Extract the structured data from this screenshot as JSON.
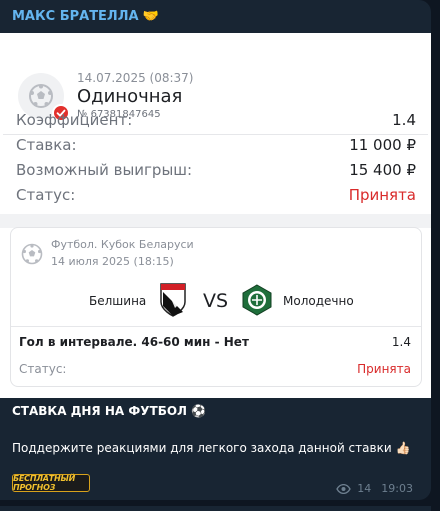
{
  "message": {
    "sender": "МАКС БРАТЕЛЛА",
    "sender_emoji": "🤝",
    "caption": "СТАВКА ДНЯ НА ФУТБОЛ",
    "caption_emoji": "⚽",
    "text": "Поддержите реакциями для легкого захода данной ставки",
    "text_emoji": "👍🏻",
    "badge": "БЕСПЛАТНЫЙ ПРОГНОЗ",
    "views": "14",
    "time": "19:03"
  },
  "coupon": {
    "date": "14.07.2025 (08:37)",
    "type": "Одиночная",
    "id": "№ 67381847645",
    "rows": [
      {
        "label": "Коэффициент:",
        "value": "1.4"
      },
      {
        "label": "Ставка:",
        "value": "11 000 ₽"
      },
      {
        "label": "Возможный выигрыш:",
        "value": "15 400 ₽"
      },
      {
        "label": "Статус:",
        "value": "Принята"
      }
    ],
    "event": {
      "league": "Футбол. Кубок Беларуси",
      "date": "14 июля 2025 (18:15)",
      "team1": "Белшина",
      "vs": "VS",
      "team2": "Молодечно",
      "bet": "Гол в интервале. 46-60 мин - Нет",
      "odds": "1.4",
      "status_label": "Статус:",
      "status_value": "Принята"
    }
  },
  "colors": {
    "accent_red": "#d92b2b",
    "sender_blue": "#64b5ef",
    "bubble": "#182533"
  }
}
